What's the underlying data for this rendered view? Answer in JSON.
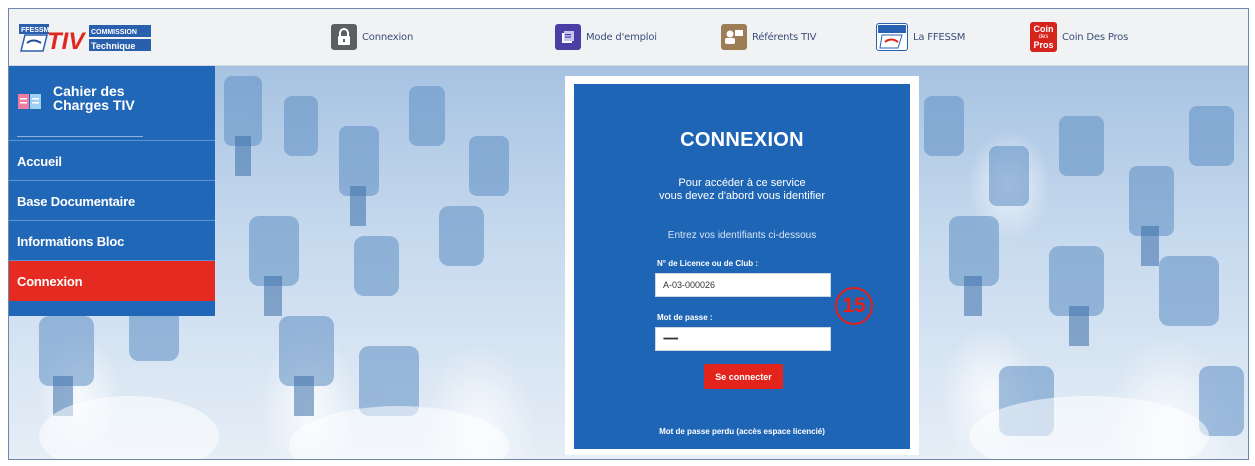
{
  "logo": {
    "brand_small": "FFESSM",
    "brand_big": "TIV",
    "line1": "COMMISSION",
    "line2": "Technique"
  },
  "nav": [
    {
      "id": "connexion",
      "label": "Connexion",
      "icon": "lock-icon",
      "color": "#5b5e63"
    },
    {
      "id": "mode",
      "label": "Mode d'emploi",
      "icon": "manual-icon",
      "color": "#4b3fa6"
    },
    {
      "id": "referents",
      "label": "Référents TIV",
      "icon": "people-icon",
      "color": "#9c7d55"
    },
    {
      "id": "ffessm",
      "label": "La FFESSM",
      "icon": "ffessm-logo-icon",
      "color": "#2861b2"
    },
    {
      "id": "coin",
      "label": "Coin Des Pros",
      "icon": "coin-des-pros-icon",
      "color": "#d5241b",
      "badge_top": "Coin",
      "badge_mid": "des",
      "badge_bottom": "Pros"
    }
  ],
  "sidebar": {
    "title_line1": "Cahier des",
    "title_line2": "Charges TIV",
    "items": [
      {
        "label": "Accueil",
        "active": false
      },
      {
        "label": "Base Documentaire",
        "active": false
      },
      {
        "label": "Informations Bloc",
        "active": false
      },
      {
        "label": "Connexion",
        "active": true
      }
    ]
  },
  "login": {
    "title": "CONNEXION",
    "message_line1": "Pour accéder à ce service",
    "message_line2": "vous devez d'abord vous identifier",
    "subtitle": "Entrez vos identifiants ci-dessous",
    "licence_label": "N° de Licence ou de Club :",
    "licence_value": "A-03-000026",
    "password_label": "Mot de passe :",
    "password_value": "••••••••••",
    "submit_label": "Se connecter",
    "forgot_label": "Mot de passe perdu (accès espace licencié)"
  },
  "annotation": {
    "step": "15"
  },
  "colors": {
    "primary": "#2167b7",
    "accent": "#e42a21",
    "card": "#1f65b5"
  }
}
